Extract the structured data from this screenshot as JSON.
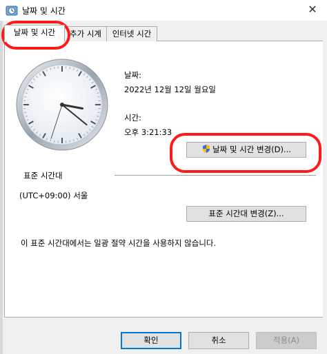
{
  "window": {
    "title": "날짜 및 시간",
    "close_glyph": "✕"
  },
  "tabs": [
    {
      "label": "날짜 및 시간"
    },
    {
      "label": "추가 시계"
    },
    {
      "label": "인터넷 시간"
    }
  ],
  "date": {
    "label": "날짜:",
    "value": "2022년 12월 12일 월요일"
  },
  "time": {
    "label": "시간:",
    "value": "오후 3:21:33",
    "hour": 15,
    "minute": 21,
    "second": 33
  },
  "buttons": {
    "change_datetime": "날짜 및 시간 변경(D)...",
    "change_timezone": "표준 시간대 변경(Z)...",
    "ok": "확인",
    "cancel": "취소",
    "apply": "적용(A)"
  },
  "timezone": {
    "section_label": "표준 시간대",
    "value": "(UTC+09:00) 서울",
    "dst_note": "이 표준 시간대에서는 일광 절약 시간을 사용하지 않습니다."
  },
  "icons": {
    "app": "clock-app-icon",
    "shield": "uac-shield-icon"
  },
  "colors": {
    "annotation": "#ff1a1a",
    "accent": "#0078d7"
  }
}
